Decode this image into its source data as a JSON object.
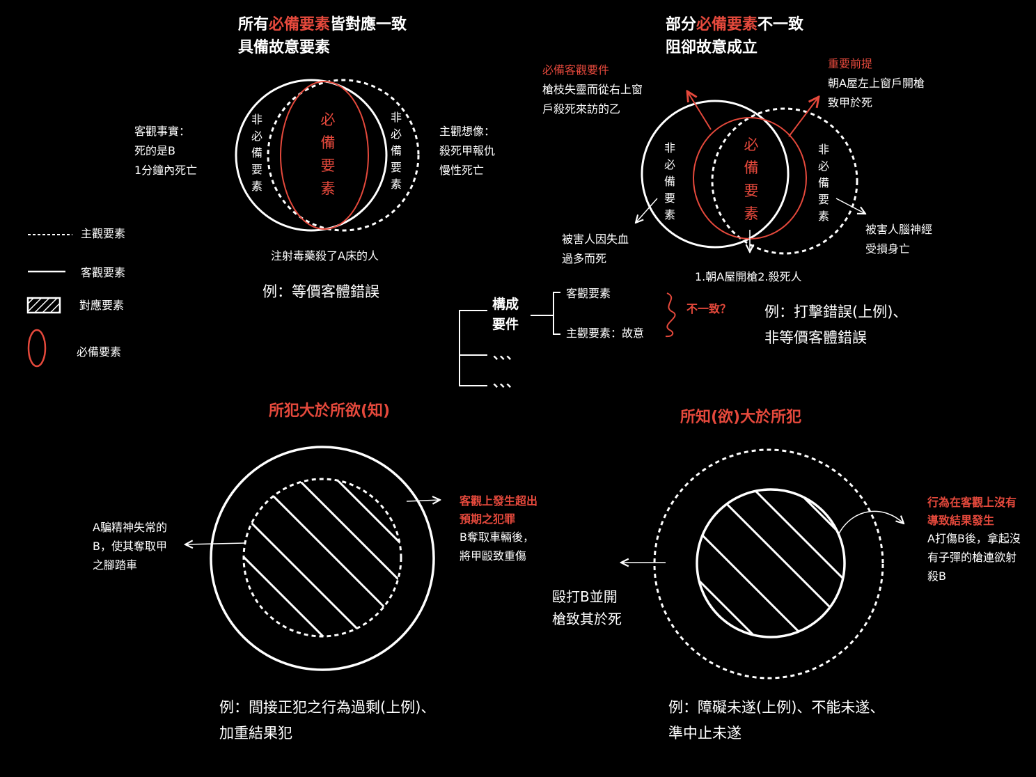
{
  "colors": {
    "background": "#000000",
    "line": "#ffffff",
    "accent": "#e5493c"
  },
  "top_left": {
    "title_prefix": "所有",
    "title_red": "必備要素",
    "title_suffix": "皆對應一致",
    "title_line2": "具備故意要素",
    "objective_label": [
      "客觀事實：",
      "死的是B",
      "1分鐘內死亡"
    ],
    "subjective_label": [
      "主觀想像：",
      "殺死甲報仇",
      "慢性死亡"
    ],
    "left_vertical": "非必備要素",
    "right_vertical": "非必備要素",
    "center_vertical": "必備要素",
    "bottom_caption": "注射毒藥殺了A床的人",
    "example": "例：等價客體錯誤"
  },
  "top_right": {
    "title_prefix": "部分",
    "title_red": "必備要素",
    "title_suffix": "不一致",
    "title_line2": "阻卻故意成立",
    "objective_required_title": "必備客觀要件",
    "objective_required_text": [
      "槍枝失靈而從右上窗",
      "戶殺死來訪的乙"
    ],
    "premise_title": "重要前提",
    "premise_text": [
      "朝A屋左上窗戶開槍",
      "致甲於死"
    ],
    "left_vertical": "非必備要素",
    "right_vertical": "非必備要素",
    "center_vertical": "必備要素",
    "left_note": [
      "被害人因失血",
      "過多而死"
    ],
    "right_note": [
      "被害人腦神經",
      "受損身亡"
    ],
    "bottom_caption": "1.朝A屋開槍2.殺死人",
    "example": [
      "例：打擊錯誤(上例)、",
      "非等價客體錯誤"
    ]
  },
  "legend": {
    "items": [
      {
        "icon": "dashed-line-icon",
        "label": "主觀要素"
      },
      {
        "icon": "solid-line-icon",
        "label": "客觀要素"
      },
      {
        "icon": "hatched-box-icon",
        "label": "對應要素"
      },
      {
        "icon": "red-ellipse-icon",
        "label": "必備要素"
      }
    ]
  },
  "structure": {
    "heading": [
      "構成",
      "要件"
    ],
    "objective": "客觀要素",
    "subjective": "主觀要素：故意",
    "mismatch": "不一致？",
    "dots1": "、、、",
    "dots2": "、、、"
  },
  "bottom_left": {
    "title": "所犯大於所欲(知)",
    "left_note": [
      "A騙精神失常的",
      "B，使其奪取甲",
      "之腳踏車"
    ],
    "right_title": [
      "客觀上發生超出",
      "預期之犯罪"
    ],
    "right_text": [
      "B奪取車輛後，",
      "將甲毆致重傷"
    ],
    "example": [
      "例：間接正犯之行為過剩(上例)、",
      "加重結果犯"
    ]
  },
  "bottom_right": {
    "title": "所知(欲)大於所犯",
    "left_note": [
      "毆打B並開",
      "槍致其於死"
    ],
    "right_title": [
      "行為在客觀上沒有",
      "導致結果發生"
    ],
    "right_text": [
      "A打傷B後，拿起沒",
      "有子彈的槍連欲射",
      "殺B"
    ],
    "example": [
      "例：障礙未遂(上例)、不能未遂、",
      "準中止未遂"
    ]
  }
}
